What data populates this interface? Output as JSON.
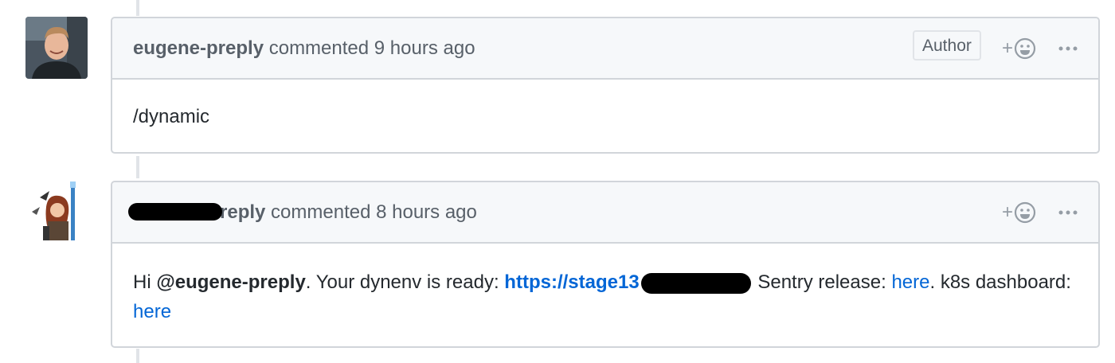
{
  "comments": [
    {
      "author": "eugene-preply",
      "action": "commented",
      "time": "9 hours ago",
      "badge": "Author",
      "reaction_label": "+",
      "body": "/dynamic"
    },
    {
      "author_visible_suffix": "reply",
      "action": "commented",
      "time": "8 hours ago",
      "reaction_label": "+",
      "body": {
        "greeting": "Hi ",
        "mention": "@eugene-preply",
        "text_1": ". Your dynenv is ready: ",
        "url_visible": "https://stage13",
        "text_2": "Sentry release: ",
        "link_1": "here",
        "text_3": ". k8s dashboard: ",
        "link_2": "here"
      }
    }
  ],
  "colors": {
    "header_bg": "#f6f8fa",
    "border": "#d1d5da",
    "link": "#0366d6",
    "muted": "#586069"
  },
  "icons": [
    "smiley-icon",
    "kebab-icon"
  ]
}
